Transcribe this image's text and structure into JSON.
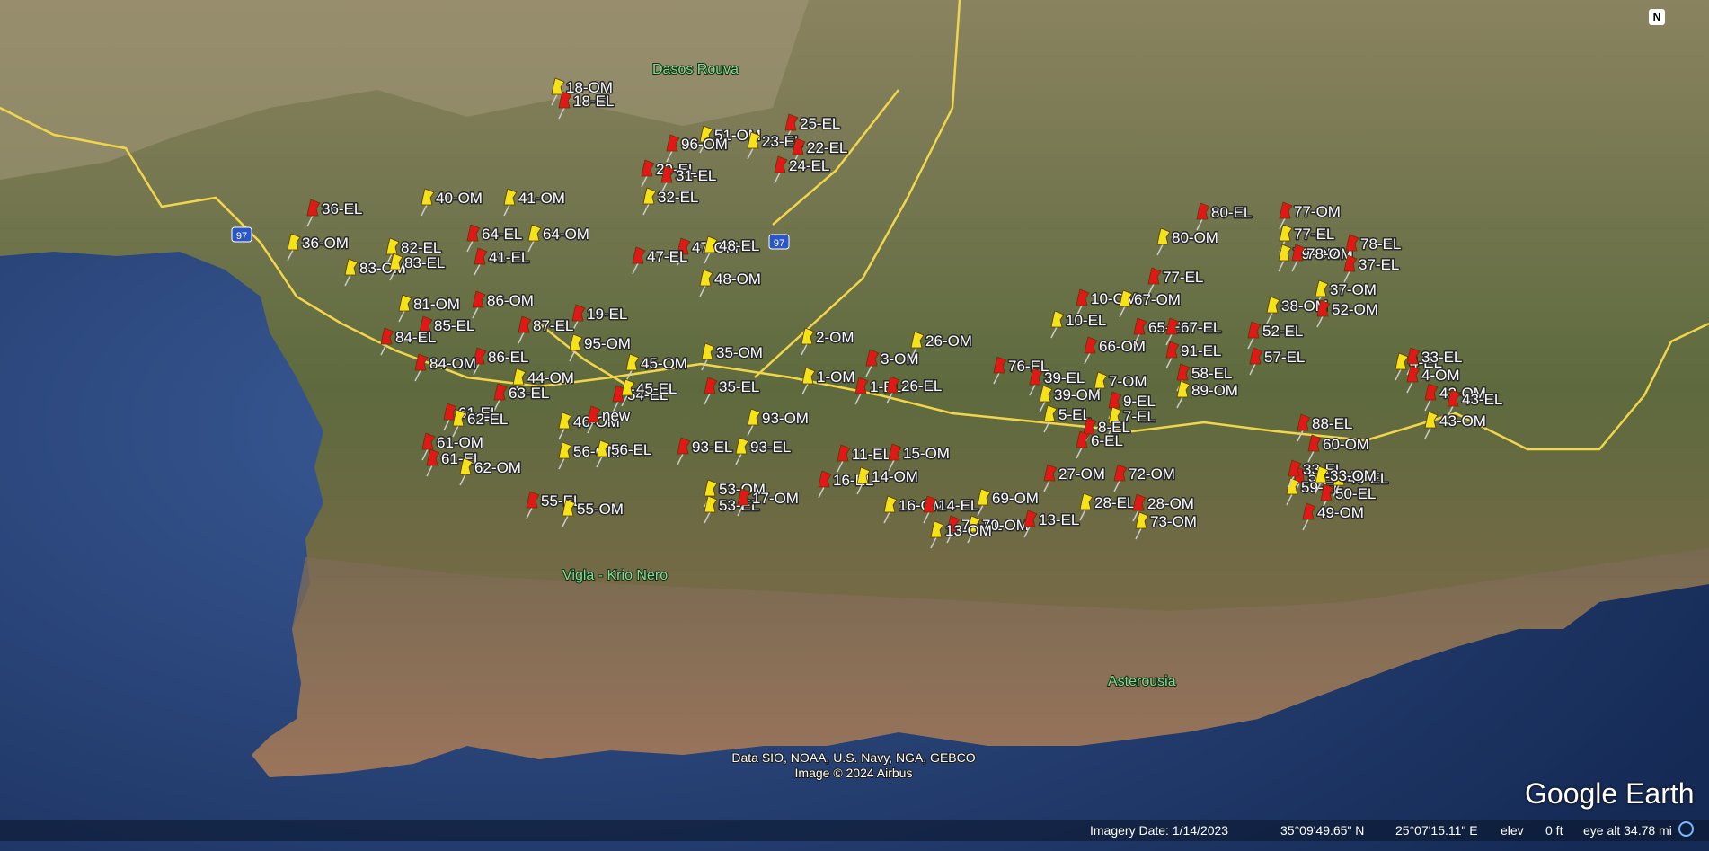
{
  "map": {
    "places": [
      {
        "id": "dasos-rouva",
        "text": "Dasos Rouva"
      },
      {
        "id": "vigla-krio-nero",
        "text": "Vigla - Krio Nero"
      },
      {
        "id": "asterousia",
        "text": "Asterousia"
      }
    ],
    "road_shield": "97",
    "attribution_line1": "Data SIO, NOAA, U.S. Navy, NGA, GEBCO",
    "attribution_line2": "Image © 2024 Airbus",
    "brand": "Google Earth",
    "compass": "N",
    "colors": {
      "sea": "#1f3c73",
      "land": "#6b6a4c",
      "road": "#f2d64a",
      "pin_red": "#e01818",
      "pin_yellow": "#f4e21a"
    },
    "pins": [
      {
        "label": "18-OM",
        "color": "yellow"
      },
      {
        "label": "18-EL",
        "color": "red"
      },
      {
        "label": "51-OM",
        "color": "yellow"
      },
      {
        "label": "25-EL",
        "color": "red"
      },
      {
        "label": "96-OM",
        "color": "red"
      },
      {
        "label": "23-EL",
        "color": "yellow"
      },
      {
        "label": "22-EL",
        "color": "red"
      },
      {
        "label": "29-EL",
        "color": "red"
      },
      {
        "label": "24-EL",
        "color": "red"
      },
      {
        "label": "31-EL",
        "color": "red"
      },
      {
        "label": "32-EL",
        "color": "yellow"
      },
      {
        "label": "36-EL",
        "color": "red"
      },
      {
        "label": "40-OM",
        "color": "yellow"
      },
      {
        "label": "41-OM",
        "color": "yellow"
      },
      {
        "label": "36-OM",
        "color": "yellow"
      },
      {
        "label": "82-EL",
        "color": "yellow"
      },
      {
        "label": "64-EL",
        "color": "red"
      },
      {
        "label": "64-OM",
        "color": "yellow"
      },
      {
        "label": "83-OM",
        "color": "yellow"
      },
      {
        "label": "83-EL",
        "color": "yellow"
      },
      {
        "label": "41-EL",
        "color": "red"
      },
      {
        "label": "47-OM",
        "color": "red"
      },
      {
        "label": "47-EL",
        "color": "red"
      },
      {
        "label": "48-EL",
        "color": "yellow"
      },
      {
        "label": "48-OM",
        "color": "yellow"
      },
      {
        "label": "86-OM",
        "color": "red"
      },
      {
        "label": "81-OM",
        "color": "yellow"
      },
      {
        "label": "19-EL",
        "color": "red"
      },
      {
        "label": "85-EL",
        "color": "red"
      },
      {
        "label": "87-EL",
        "color": "red"
      },
      {
        "label": "95-OM",
        "color": "yellow"
      },
      {
        "label": "84-EL",
        "color": "red"
      },
      {
        "label": "86-EL",
        "color": "red"
      },
      {
        "label": "84-OM",
        "color": "red"
      },
      {
        "label": "45-OM",
        "color": "yellow"
      },
      {
        "label": "35-OM",
        "color": "yellow"
      },
      {
        "label": "44-OM",
        "color": "yellow"
      },
      {
        "label": "63-EL",
        "color": "red"
      },
      {
        "label": "54-EL",
        "color": "red"
      },
      {
        "label": "45-EL",
        "color": "yellow"
      },
      {
        "label": "35-EL",
        "color": "red"
      },
      {
        "label": "61-EL",
        "color": "red"
      },
      {
        "label": "62-EL",
        "color": "yellow"
      },
      {
        "label": "46-OM",
        "color": "yellow"
      },
      {
        "label": "new",
        "color": "red"
      },
      {
        "label": "61-OM",
        "color": "red"
      },
      {
        "label": "56-OM",
        "color": "yellow"
      },
      {
        "label": "56-EL",
        "color": "yellow"
      },
      {
        "label": "61-EL",
        "color": "red"
      },
      {
        "label": "62-OM",
        "color": "yellow"
      },
      {
        "label": "93-OM",
        "color": "yellow"
      },
      {
        "label": "93-EL",
        "color": "red"
      },
      {
        "label": "93-EL",
        "color": "yellow"
      },
      {
        "label": "53-OM",
        "color": "yellow"
      },
      {
        "label": "55-EL",
        "color": "red"
      },
      {
        "label": "55-OM",
        "color": "yellow"
      },
      {
        "label": "53-EL",
        "color": "yellow"
      },
      {
        "label": "17-OM",
        "color": "red"
      },
      {
        "label": "2-OM",
        "color": "yellow"
      },
      {
        "label": "3-OM",
        "color": "red"
      },
      {
        "label": "1-OM",
        "color": "yellow"
      },
      {
        "label": "1-EL",
        "color": "red"
      },
      {
        "label": "26-OM",
        "color": "yellow"
      },
      {
        "label": "26-EL",
        "color": "red"
      },
      {
        "label": "11-EL",
        "color": "red"
      },
      {
        "label": "15-OM",
        "color": "red"
      },
      {
        "label": "16-EL",
        "color": "red"
      },
      {
        "label": "14-OM",
        "color": "yellow"
      },
      {
        "label": "16-OM",
        "color": "yellow"
      },
      {
        "label": "14-EL",
        "color": "red"
      },
      {
        "label": "70-EL",
        "color": "red"
      },
      {
        "label": "70-OM",
        "color": "yellow"
      },
      {
        "label": "13-EL",
        "color": "red"
      },
      {
        "label": "69-OM",
        "color": "yellow"
      },
      {
        "label": "13-OM",
        "color": "yellow"
      },
      {
        "label": "76-EL",
        "color": "red"
      },
      {
        "label": "39-EL",
        "color": "red"
      },
      {
        "label": "39-OM",
        "color": "yellow"
      },
      {
        "label": "5-EL",
        "color": "yellow"
      },
      {
        "label": "7-OM",
        "color": "yellow"
      },
      {
        "label": "9-EL",
        "color": "red"
      },
      {
        "label": "7-EL",
        "color": "yellow"
      },
      {
        "label": "8-EL",
        "color": "red"
      },
      {
        "label": "6-EL",
        "color": "red"
      },
      {
        "label": "27-OM",
        "color": "red"
      },
      {
        "label": "72-OM",
        "color": "red"
      },
      {
        "label": "28-EL",
        "color": "yellow"
      },
      {
        "label": "28-OM",
        "color": "red"
      },
      {
        "label": "73-OM",
        "color": "yellow"
      },
      {
        "label": "10-OM",
        "color": "red"
      },
      {
        "label": "10-EL",
        "color": "yellow"
      },
      {
        "label": "67-OM",
        "color": "yellow"
      },
      {
        "label": "66-OM",
        "color": "red"
      },
      {
        "label": "65-EL",
        "color": "red"
      },
      {
        "label": "67-EL",
        "color": "red"
      },
      {
        "label": "91-EL",
        "color": "red"
      },
      {
        "label": "80-EL",
        "color": "red"
      },
      {
        "label": "80-OM",
        "color": "yellow"
      },
      {
        "label": "77-EL",
        "color": "red"
      },
      {
        "label": "77-OM",
        "color": "red"
      },
      {
        "label": "77-EL",
        "color": "yellow"
      },
      {
        "label": "79-OM",
        "color": "yellow"
      },
      {
        "label": "78-OM",
        "color": "red"
      },
      {
        "label": "78-EL",
        "color": "red"
      },
      {
        "label": "37-EL",
        "color": "red"
      },
      {
        "label": "37-OM",
        "color": "yellow"
      },
      {
        "label": "38-OM",
        "color": "yellow"
      },
      {
        "label": "52-OM",
        "color": "red"
      },
      {
        "label": "52-EL",
        "color": "red"
      },
      {
        "label": "57-EL",
        "color": "red"
      },
      {
        "label": "58-EL",
        "color": "red"
      },
      {
        "label": "89-OM",
        "color": "yellow"
      },
      {
        "label": "88-EL",
        "color": "red"
      },
      {
        "label": "60-OM",
        "color": "red"
      },
      {
        "label": "59-OM",
        "color": "red"
      },
      {
        "label": "59-EL",
        "color": "yellow"
      },
      {
        "label": "50-EL",
        "color": "red"
      },
      {
        "label": "49-OM",
        "color": "red"
      },
      {
        "label": "49-EL",
        "color": "yellow"
      },
      {
        "label": "33-EL",
        "color": "red"
      },
      {
        "label": "33-OM",
        "color": "yellow"
      },
      {
        "label": "4-EL",
        "color": "yellow"
      },
      {
        "label": "33-EL",
        "color": "red"
      },
      {
        "label": "4-OM",
        "color": "red"
      },
      {
        "label": "42-OM",
        "color": "red"
      },
      {
        "label": "43-EL",
        "color": "red"
      },
      {
        "label": "43-OM",
        "color": "yellow"
      }
    ]
  },
  "status": {
    "imagery_date": "Imagery Date: 1/14/2023",
    "lat": "35°09'49.65\" N",
    "lon": "25°07'15.11\" E",
    "elev_label": "elev",
    "elev_value": "0 ft",
    "eye_alt": "eye alt  34.78 mi"
  }
}
